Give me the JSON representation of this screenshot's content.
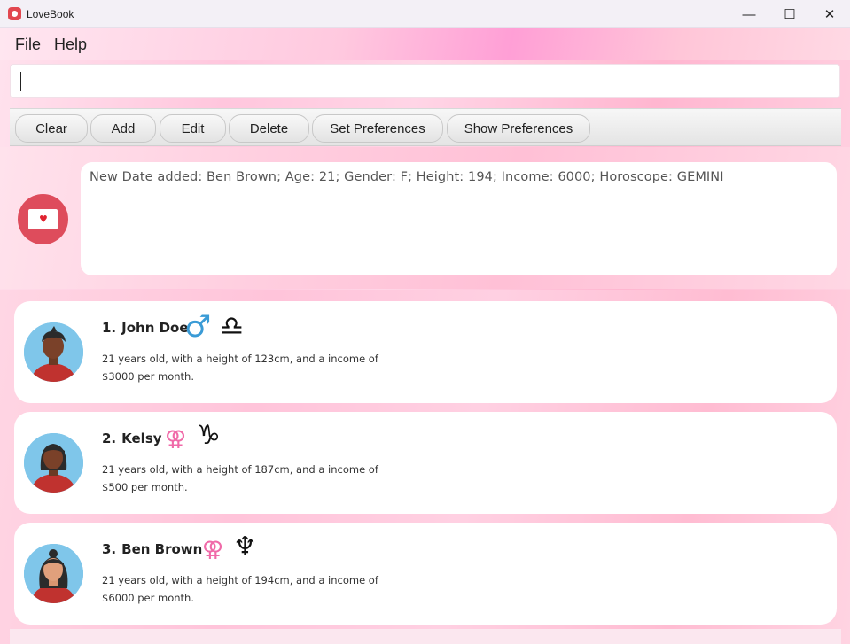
{
  "window": {
    "title": "LoveBook",
    "controls": {
      "minimize": "—",
      "maximize": "☐",
      "close": "✕"
    }
  },
  "menu": {
    "file": "File",
    "help": "Help"
  },
  "command": {
    "value": "",
    "placeholder": ""
  },
  "toolbar": {
    "buttons": [
      "Clear",
      "Add",
      "Edit",
      "Delete",
      "Set Preferences",
      "Show Preferences"
    ]
  },
  "result": {
    "message": "New Date added: Ben Brown; Age: 21; Gender: F; Height: 194; Income: 6000; Horoscope: GEMINI"
  },
  "dates": [
    {
      "index": "1.",
      "name": "John Doe",
      "gender_icon": "♂",
      "horoscope_icon": "♎",
      "line1": "21 years old, with a height of 123cm, and a income of",
      "line2": "$3000 per month."
    },
    {
      "index": "2.",
      "name": "Kelsy",
      "gender_icon": "⚢",
      "horoscope_icon": "♑",
      "line1": "21 years old, with a height of 187cm, and a income of",
      "line2": "$500 per month."
    },
    {
      "index": "3.",
      "name": "Ben Brown",
      "gender_icon": "⚢",
      "horoscope_icon": "♆",
      "line1": "21 years old, with a height of 194cm, and a income of",
      "line2": "$6000 per month."
    }
  ],
  "colors": {
    "accent": "#de4c5c",
    "male": "#3a9bd6",
    "female": "#f06aa8"
  }
}
